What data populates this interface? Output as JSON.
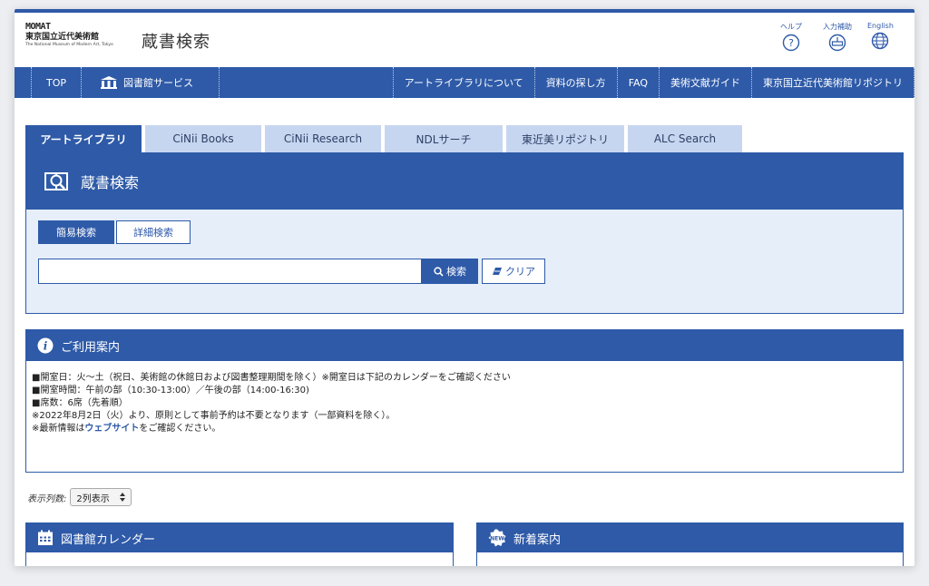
{
  "header": {
    "logo_mark": "MOMAT",
    "logo_jp": "東京国立近代美術館",
    "logo_en": "The National Museum of Modern Art, Tokyo",
    "site_title": "蔵書検索",
    "utilities": [
      {
        "label": "ヘルプ",
        "icon": "help-icon"
      },
      {
        "label": "入力補助",
        "icon": "keyboard-icon"
      },
      {
        "label": "English",
        "icon": "globe-icon"
      }
    ]
  },
  "nav": {
    "top": "TOP",
    "library_services": "図書館サービス",
    "about": "アートライブラリについて",
    "how_to": "資料の探し方",
    "faq": "FAQ",
    "guide": "美術文献ガイド",
    "repository": "東京国立近代美術館リポジトリ"
  },
  "tabs": [
    "アートライブラリ",
    "CiNii Books",
    "CiNii Research",
    "NDLサーチ",
    "東近美リポジトリ",
    "ALC Search"
  ],
  "search": {
    "heading": "蔵書検索",
    "mode_simple": "簡易検索",
    "mode_advanced": "詳細検索",
    "input_value": "",
    "search_button": "検索",
    "clear_button": "クリア"
  },
  "info": {
    "heading": "ご利用案内",
    "lines": [
      "■開室日：火～土（祝日、美術館の休館日および図書整理期間を除く）※開室日は下記のカレンダーをご確認ください",
      "■開室時間：午前の部（10:30-13:00）／午後の部（14:00-16:30)",
      "■席数：6席（先着順）",
      "※2022年8月2日（火）より、原則として事前予約は不要となります（一部資料を除く）。"
    ],
    "last_prefix": "※最新情報は",
    "last_link": "ウェブサイト",
    "last_suffix": "をご確認ください。"
  },
  "columns": {
    "label": "表示列数:",
    "selected": "2列表示"
  },
  "cards": {
    "calendar": "図書館カレンダー",
    "news": "新着案内"
  },
  "colors": {
    "accent": "#2e5aa8",
    "tab_inactive": "#c7d6f0",
    "panel_bg": "#e6eef9"
  }
}
